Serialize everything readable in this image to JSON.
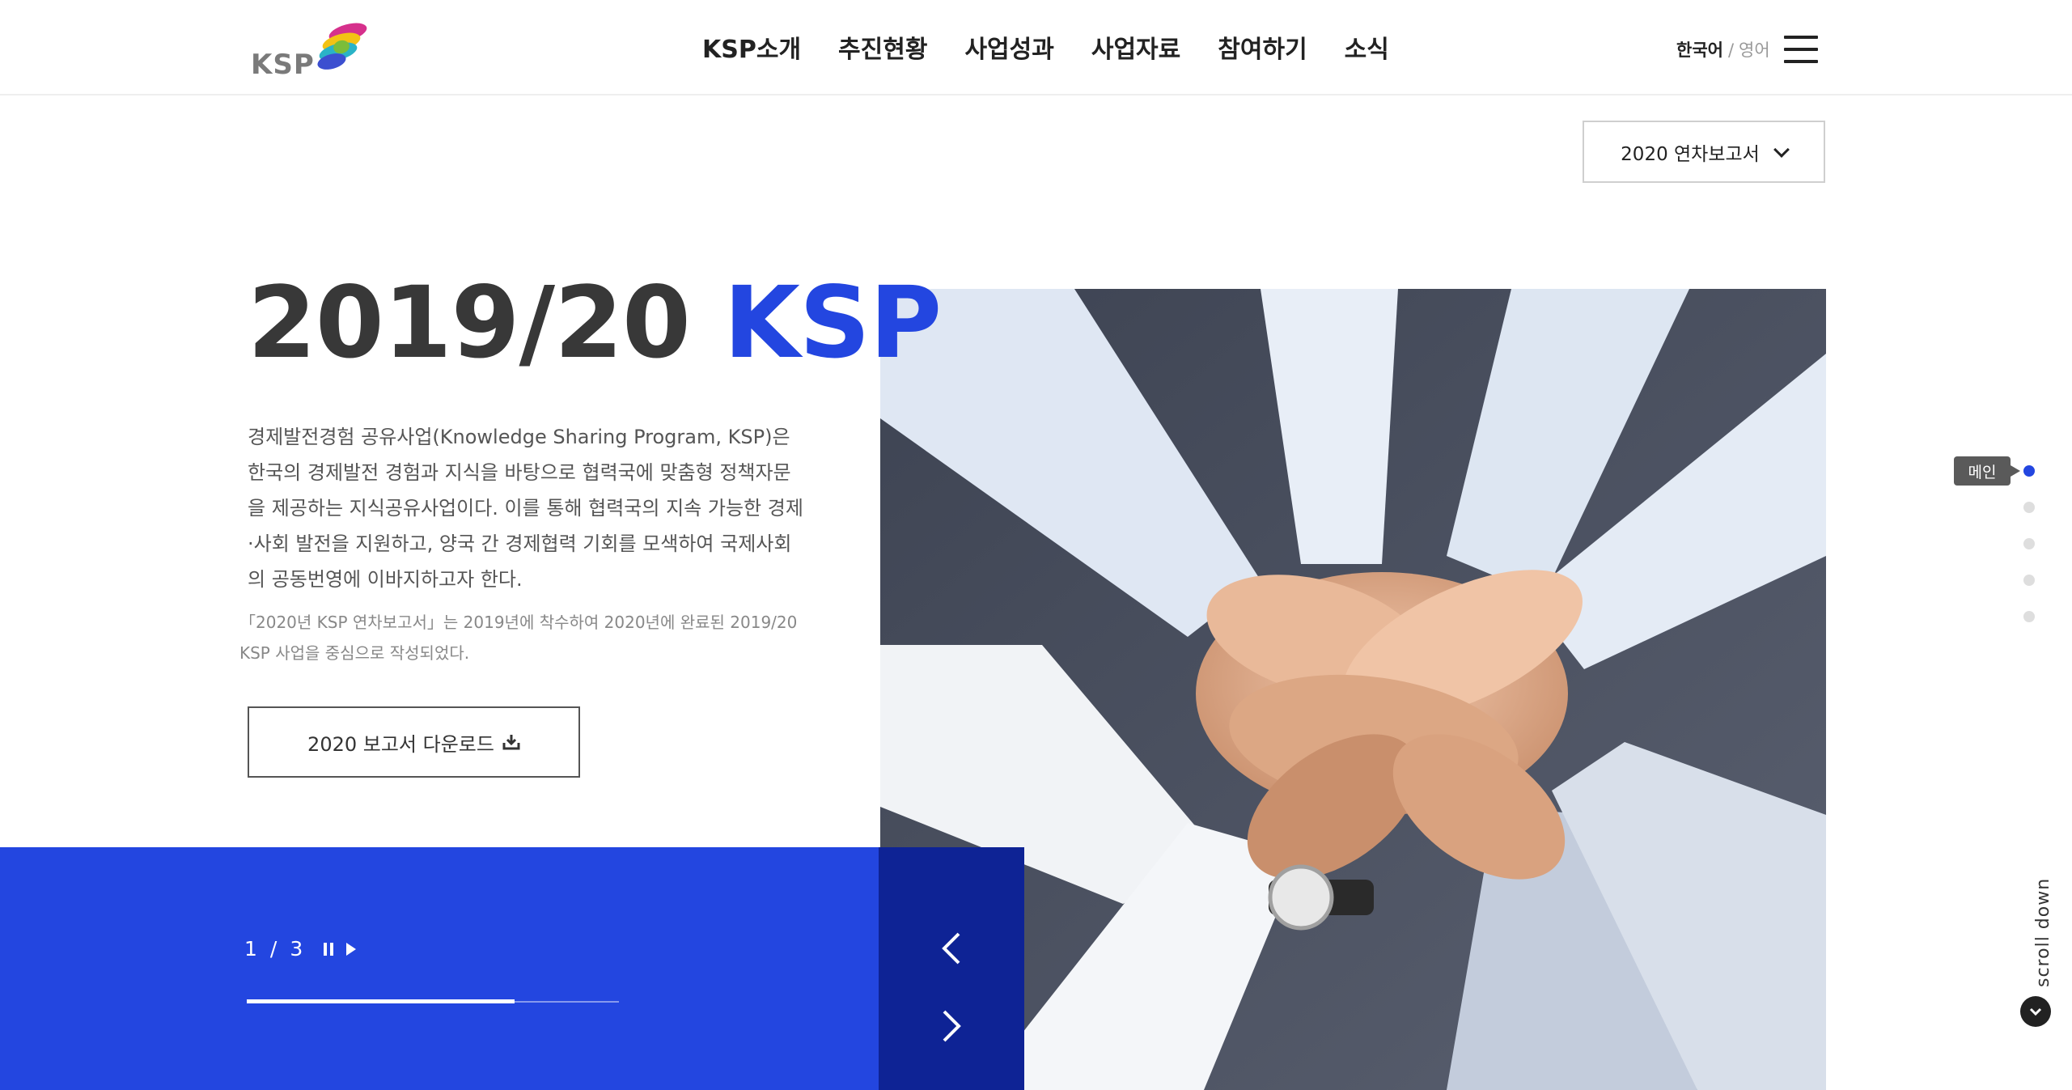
{
  "header": {
    "logo_text": "KSP",
    "nav": [
      "KSP소개",
      "추진현황",
      "사업성과",
      "사업자료",
      "참여하기",
      "소식"
    ],
    "lang_ko": "한국어",
    "lang_sep": "/",
    "lang_en": "영어"
  },
  "report_select": {
    "label": "2020 연차보고서"
  },
  "hero": {
    "title_main": "2019/20",
    "title_accent": "KSP",
    "description": "경제발전경험 공유사업(Knowledge Sharing Program, KSP)은 한국의 경제발전 경험과 지식을 바탕으로 협력국에 맞춤형 정책자문을 제공하는 지식공유사업이다. 이를 통해 협력국의 지속 가능한 경제·사회 발전을 지원하고, 양국 간 경제협력 기회를 모색하여 국제사회의 공동번영에 이바지하고자 한다.",
    "note": "「2020년 KSP 연차보고서」는 2019년에 착수하여 2020년에 완료된 2019/20 KSP 사업을 중심으로 작성되었다.",
    "download_label": "2020 보고서 다운로드"
  },
  "slider": {
    "current": "1",
    "separator": "/",
    "total": "3",
    "progress": 0.72
  },
  "rail": {
    "active_label": "메인",
    "dots": 5,
    "active_index": 0,
    "scroll_label": "scroll down"
  },
  "colors": {
    "accent": "#2346e0",
    "dark_accent": "#0e2395",
    "title": "#383838"
  },
  "icons": [
    "hamburger-menu-icon",
    "chevron-down-icon",
    "download-icon",
    "pause-icon",
    "play-icon",
    "arrow-left-icon",
    "arrow-right-icon",
    "chevron-down-circle-icon"
  ]
}
